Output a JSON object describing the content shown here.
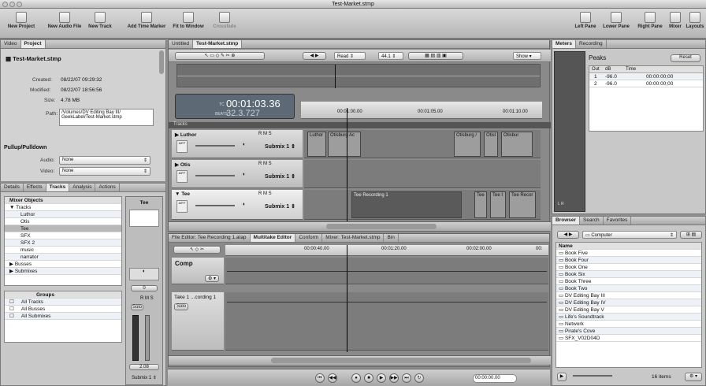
{
  "window": {
    "title": "Test-Market.stmp"
  },
  "toolbar": {
    "left": [
      {
        "label": "New Project"
      },
      {
        "label": "New Audio File"
      },
      {
        "label": "New Track"
      },
      {
        "label": "Add Time Marker"
      },
      {
        "label": "Fit to Window"
      },
      {
        "label": "Crossfade"
      }
    ],
    "right": [
      {
        "label": "Left Pane"
      },
      {
        "label": "Lower Pane"
      },
      {
        "label": "Right Pane"
      },
      {
        "label": "Mixer"
      },
      {
        "label": "Layouts"
      }
    ]
  },
  "left_pane": {
    "tabs": [
      "Video",
      "Project"
    ],
    "project_name": "Test-Market.stmp",
    "created_label": "Created:",
    "created_value": "08/22/07  09:29:32",
    "modified_label": "Modified:",
    "modified_value": "08/22/07  18:56:56",
    "size_label": "Size:",
    "size_value": "4.78 MB",
    "path_label": "Path:",
    "path_value_1": "/Volumes/DV Editing Bay III/",
    "path_value_2": "GeekLabel/Test-Market.stmp",
    "pullup_title": "Pullup/Pulldown",
    "audio_label": "Audio:",
    "audio_value": "None",
    "video_label": "Video:",
    "video_value": "None"
  },
  "lower_left": {
    "tabs": [
      "Details",
      "Effects",
      "Tracks",
      "Analysis",
      "Actions"
    ],
    "mixer_objects": "Mixer Objects",
    "tracks_header": "Tracks",
    "tracks": [
      "Luthor",
      "Otis",
      "Tee",
      "SFX",
      "SFX 2",
      "music",
      "narrator"
    ],
    "busses": "Busses",
    "submixes": "Submixes",
    "groups_header": "Groups",
    "groups": [
      "All Tracks",
      "All Busses",
      "All Submixes"
    ],
    "strip_name": "Tee",
    "strip_value": "0",
    "strip_rms": "R M S",
    "strip_solo": "Solo",
    "strip_level": "2.08",
    "strip_output": "Submix 1"
  },
  "center": {
    "doc_tabs": [
      "Untitled",
      "Test-Market.stmp"
    ],
    "read_mode": "Read",
    "sample_rate": "44.1",
    "show_label": "Show",
    "timecode": "00:01:03.36",
    "tc_prefix": "TC",
    "beats_prefix": "BEATS",
    "beats": "32.3.727",
    "ruler_marks": [
      "00:01:00.00",
      "00:01:05.00",
      "00:01:10.00"
    ],
    "tracks_label": "Tracks",
    "tracks": [
      {
        "name": "Luthor",
        "output": "Submix 1",
        "rms": "R M S"
      },
      {
        "name": "Otis",
        "output": "Submix 1",
        "rms": "R M S"
      },
      {
        "name": "Tee",
        "output": "Submix 1",
        "rms": "R M S"
      }
    ],
    "clips_luthor": [
      "Luthor",
      "Otisburg Ac",
      "Otisburg /",
      "Otisl",
      "Otisbur"
    ],
    "clips_tee": [
      "Tee Recording 1",
      "Tee",
      "Tee I",
      "Tee Recor"
    ],
    "track_icon_label": "AIFF"
  },
  "lower_center": {
    "tabs": [
      "File Editor: Tee Recording 1.atap",
      "Multitake Editor",
      "Conform",
      "Mixer: Test-Market.stmp",
      "Bin"
    ],
    "ruler_marks": [
      "00:00:40.00",
      "00:01:20.00",
      "00:02:00.00",
      "00:"
    ],
    "comp_label": "Comp",
    "take_label": "Take 1 ...cording 1",
    "solo_label": "Solo"
  },
  "transport": {
    "timecode": "00:00:00.00"
  },
  "right_pane": {
    "tabs": [
      "Meters",
      "Recording"
    ],
    "peaks_title": "Peaks",
    "reset_label": "Reset",
    "columns": [
      "Out",
      "dB",
      "Time"
    ],
    "rows": [
      {
        "out": "1",
        "db": "-96.0",
        "time": "00:00:00;00"
      },
      {
        "out": "2",
        "db": "-96.0",
        "time": "00:00:00;00"
      }
    ],
    "meter_scale": [
      "-6",
      "-12",
      "-20",
      "-30",
      "-40",
      "-60"
    ],
    "lr_label": "L  R"
  },
  "browser": {
    "tabs": [
      "Browser",
      "Search",
      "Favorites"
    ],
    "location": "Computer",
    "name_header": "Name",
    "items": [
      "Book Five",
      "Book Four",
      "Book One",
      "Book Six",
      "Book Three",
      "Book Two",
      "DV Editing Bay III",
      "DV Editing Bay IV",
      "DV Editing Bay V",
      "Life's Soundtrack",
      "Network",
      "Pirate's Cove",
      "SFX_V02D04D"
    ],
    "count": "16 items"
  }
}
